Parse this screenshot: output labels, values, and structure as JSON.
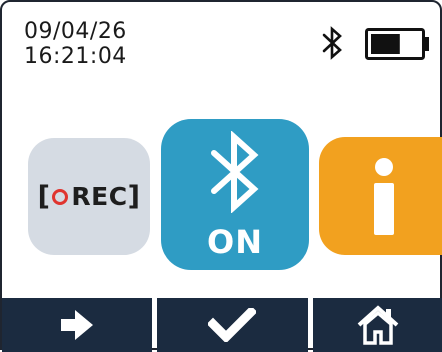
{
  "status": {
    "date": "09/04/26",
    "time": "16:21:04",
    "bluetooth_icon": "bluetooth-icon",
    "battery_icon": "battery-icon",
    "battery_level": 0.6
  },
  "tiles": {
    "rec": {
      "label": "REC",
      "icon": "record-icon"
    },
    "bluetooth": {
      "label": "ON",
      "icon": "bluetooth-icon"
    },
    "info": {
      "icon": "info-icon"
    }
  },
  "nav": {
    "next_icon": "arrow-right-icon",
    "ok_icon": "checkmark-icon",
    "home_icon": "home-icon"
  },
  "colors": {
    "bluetooth_tile": "#2f9cc4",
    "info_tile": "#f2a11f",
    "rec_tile": "#d5dbe3",
    "record_dot": "#e0342f",
    "nav_bar": "#1b2b40"
  }
}
